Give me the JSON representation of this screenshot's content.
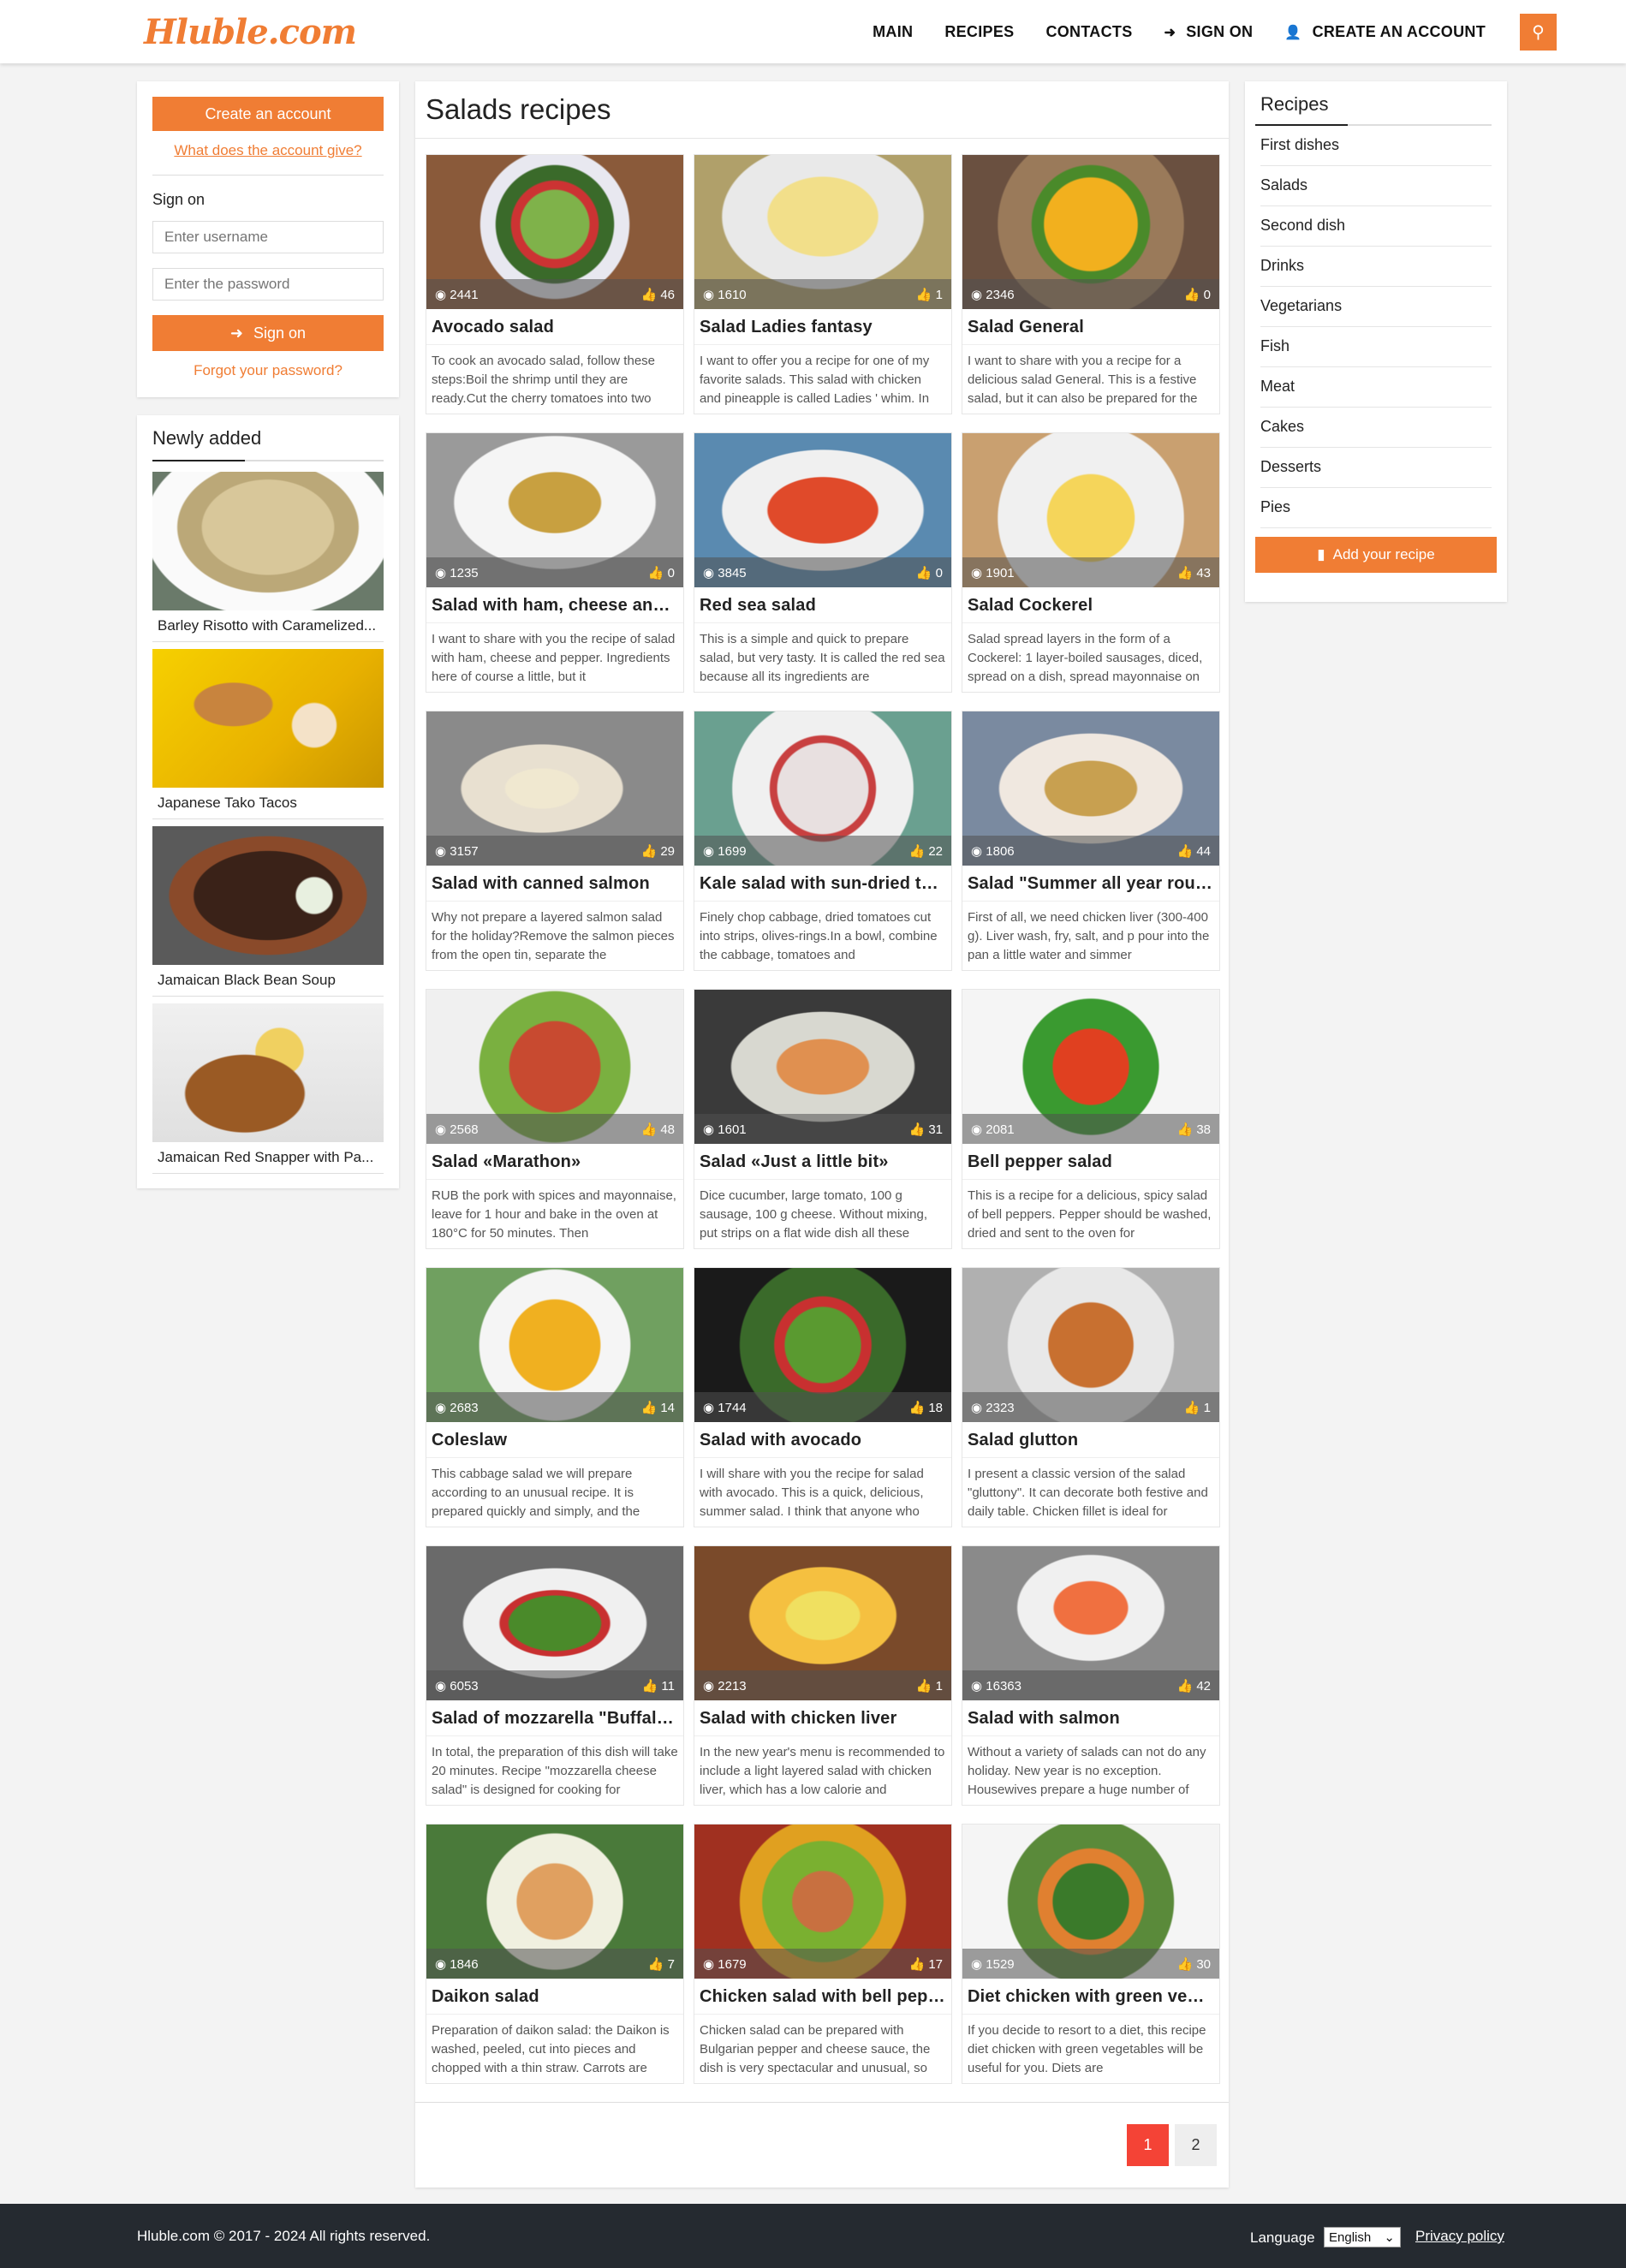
{
  "header": {
    "logo": "Hluble.com",
    "nav": {
      "main": "MAIN",
      "recipes": "RECIPES",
      "contacts": "CONTACTS",
      "sign_on": "SIGN ON",
      "create_account": "CREATE AN ACCOUNT"
    }
  },
  "login": {
    "create_account": "Create an account",
    "what_gives": "What does the account give?",
    "sign_on_title": "Sign on",
    "username_placeholder": "Enter username",
    "password_placeholder": "Enter the password",
    "sign_on_button": "Sign on",
    "forgot": "Forgot your password?"
  },
  "newly": {
    "title": "Newly added",
    "items": [
      {
        "label": "Barley Risotto with Caramelized..."
      },
      {
        "label": "Japanese Tako Tacos"
      },
      {
        "label": "Jamaican Black Bean Soup"
      },
      {
        "label": "Jamaican Red Snapper with Pa..."
      }
    ]
  },
  "main": {
    "title": "Salads recipes",
    "recipes": [
      {
        "title": "Avocado salad",
        "views": "2441",
        "likes": "46",
        "desc": "To cook an avocado salad, follow these steps:Boil the shrimp until they are ready.Cut the cherry tomatoes into two"
      },
      {
        "title": "Salad Ladies fantasy",
        "views": "1610",
        "likes": "1",
        "desc": "I want to offer you a recipe for one of my favorite salads. This salad with chicken and pineapple is called Ladies ' whim. In"
      },
      {
        "title": "Salad General",
        "views": "2346",
        "likes": "0",
        "desc": "I want to share with you a recipe for a delicious salad General. This is a festive salad, but it can also be prepared for the"
      },
      {
        "title": "Salad with ham, cheese and s...",
        "views": "1235",
        "likes": "0",
        "desc": "I want to share with you the recipe of salad with ham, cheese and pepper. Ingredients here of course a little, but it"
      },
      {
        "title": "Red sea salad",
        "views": "3845",
        "likes": "0",
        "desc": "This is a simple and quick to prepare salad, but very tasty. It is called the red sea because all its ingredients are"
      },
      {
        "title": "Salad Cockerel",
        "views": "1901",
        "likes": "43",
        "desc": "Salad spread layers in the form of a Cockerel: 1 layer-boiled sausages, diced, spread on a dish, spread mayonnaise on"
      },
      {
        "title": "Salad with canned salmon",
        "views": "3157",
        "likes": "29",
        "desc": "Why not prepare a layered salmon salad for the holiday?Remove the salmon pieces from the open tin, separate the"
      },
      {
        "title": "Kale salad with sun-dried tom...",
        "views": "1699",
        "likes": "22",
        "desc": "Finely chop cabbage, dried tomatoes cut into strips, olives-rings.In a bowl, combine the cabbage, tomatoes and"
      },
      {
        "title": "Salad \"Summer all year round»",
        "views": "1806",
        "likes": "44",
        "desc": "First of all, we need chicken liver (300-400 g). Liver wash, fry, salt, and p pour into the pan a little water and simmer"
      },
      {
        "title": "Salad «Marathon»",
        "views": "2568",
        "likes": "48",
        "desc": "RUB the pork with spices and mayonnaise, leave for 1 hour and bake in the oven at 180°C for 50 minutes. Then"
      },
      {
        "title": "Salad «Just a little bit»",
        "views": "1601",
        "likes": "31",
        "desc": "Dice cucumber, large tomato, 100 g sausage, 100 g cheese. Without mixing, put strips on a flat wide dish all these"
      },
      {
        "title": "Bell pepper salad",
        "views": "2081",
        "likes": "38",
        "desc": "This is a recipe for a delicious, spicy salad of bell peppers. Pepper should be washed, dried and sent to the oven for"
      },
      {
        "title": "Coleslaw",
        "views": "2683",
        "likes": "14",
        "desc": "This cabbage salad we will prepare according to an unusual recipe. It is prepared quickly and simply, and the"
      },
      {
        "title": "Salad with avocado",
        "views": "1744",
        "likes": "18",
        "desc": "I will share with you the recipe for salad with avocado. This is a quick, delicious, summer salad. I think that anyone who"
      },
      {
        "title": "Salad glutton",
        "views": "2323",
        "likes": "1",
        "desc": "I present a classic version of the salad \"gluttony\". It can decorate both festive and daily table. Chicken fillet is ideal for"
      },
      {
        "title": "Salad of mozzarella \"Buffalo\" ...",
        "views": "6053",
        "likes": "11",
        "desc": "In total, the preparation of this dish will take 20 minutes. Recipe \"mozzarella cheese salad\" is designed for cooking for"
      },
      {
        "title": "Salad with chicken liver",
        "views": "2213",
        "likes": "1",
        "desc": "In the new year's menu is recommended to include a light layered salad with chicken liver, which has a low calorie and"
      },
      {
        "title": "Salad with salmon",
        "views": "16363",
        "likes": "42",
        "desc": "Without a variety of salads can not do any holiday. New year is no exception. Housewives prepare a huge number of"
      },
      {
        "title": "Daikon salad",
        "views": "1846",
        "likes": "7",
        "desc": "Preparation of daikon salad: the Daikon is washed, peeled, cut into pieces and chopped with a thin straw. Carrots are"
      },
      {
        "title": "Chicken salad with bell pepper...",
        "views": "1679",
        "likes": "17",
        "desc": "Chicken salad can be prepared with Bulgarian pepper and cheese sauce, the dish is very spectacular and unusual, so"
      },
      {
        "title": "Diet chicken with green vegeta...",
        "views": "1529",
        "likes": "30",
        "desc": "If you decide to resort to a diet, this recipe diet chicken with green vegetables will be useful for you. Diets are"
      }
    ]
  },
  "pagination": {
    "page1": "1",
    "page2": "2"
  },
  "sidebar": {
    "title": "Recipes",
    "items": [
      "First dishes",
      "Salads",
      "Second dish",
      "Drinks",
      "Vegetarians",
      "Fish",
      "Meat",
      "Cakes",
      "Desserts",
      "Pies"
    ],
    "add_recipe": "Add your recipe"
  },
  "footer": {
    "copyright": "Hluble.com © 2017 - 2024 All rights reserved.",
    "language_label": "Language",
    "language_value": "English",
    "privacy": "Privacy policy"
  },
  "colors": {
    "accent": "#f07d34",
    "active_page": "#f44336",
    "footer_bg": "#252a30"
  }
}
